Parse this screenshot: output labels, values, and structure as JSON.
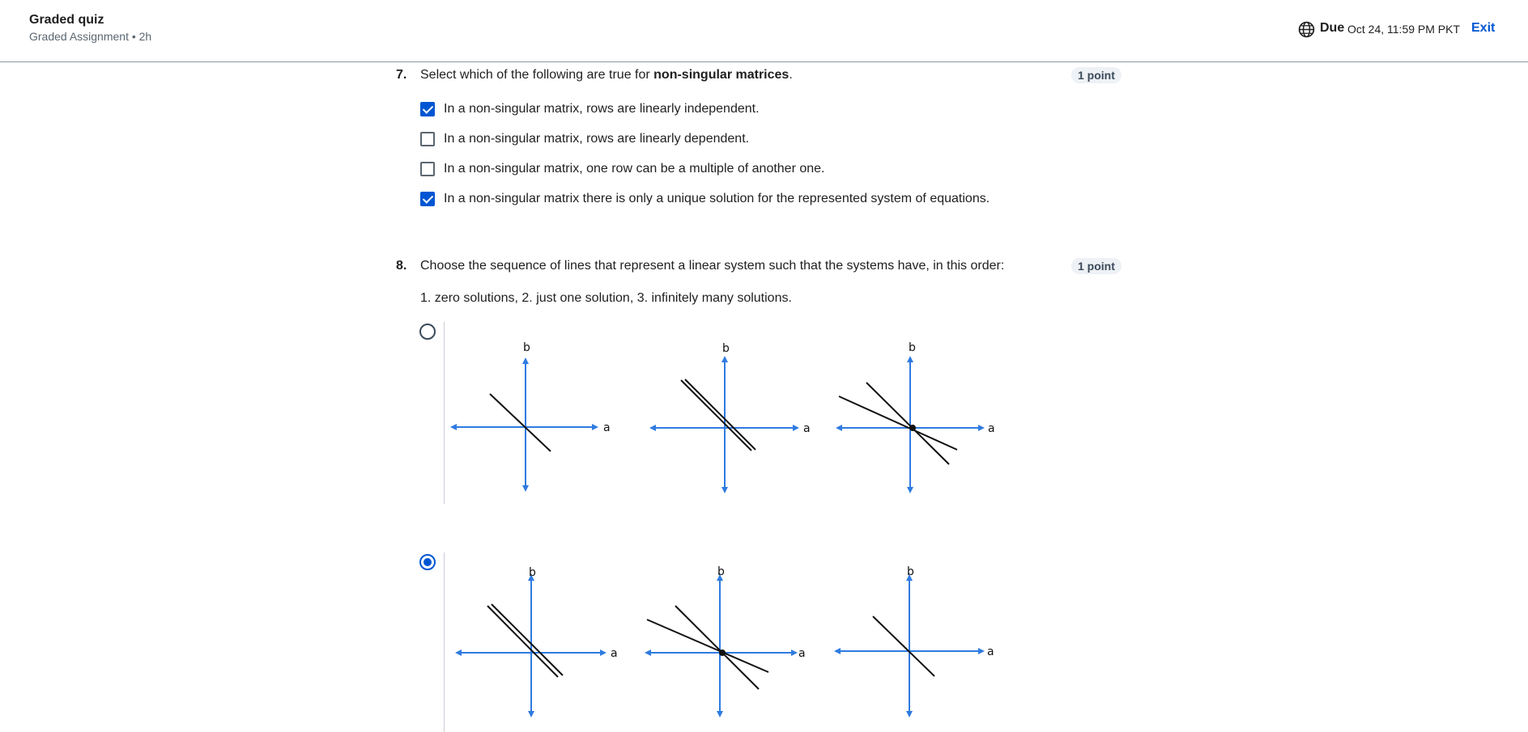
{
  "header": {
    "title": "Graded quiz",
    "subtitle": "Graded Assignment • 2h",
    "due_label": "Due",
    "due_date": "Oct 24, 11:59 PM PKT",
    "exit_label": "Exit",
    "globe_icon": "globe-icon"
  },
  "q7": {
    "number": "7.",
    "text_before": "Select which of the following are true for ",
    "text_bold": "non-singular matrices",
    "text_after": ".",
    "points": "1 point",
    "options": [
      {
        "label": "In a non-singular matrix, rows are linearly independent.",
        "checked": true
      },
      {
        "label": "In a non-singular matrix, rows are linearly dependent.",
        "checked": false
      },
      {
        "label": "In a non-singular matrix, one row can be a multiple of another one.",
        "checked": false
      },
      {
        "label": "In a non-singular matrix there is only a unique solution for the represented system of equations.",
        "checked": true
      }
    ]
  },
  "q8": {
    "number": "8.",
    "text": "Choose the sequence of lines that represent a linear system such that the systems have, in this order:",
    "subtext": "1. zero solutions, 2. just one solution, 3. infinitely many solutions.",
    "points": "1 point",
    "axis_x_label": "a",
    "axis_y_label": "b",
    "options": [
      {
        "selected": false,
        "graphs": [
          "single-line",
          "parallel-lines",
          "intersecting-lines"
        ]
      },
      {
        "selected": true,
        "graphs": [
          "parallel-lines",
          "intersecting-lines",
          "single-line"
        ]
      }
    ]
  },
  "colors": {
    "accent": "#0056d2",
    "axis": "#2f7be0",
    "line": "#111111"
  }
}
